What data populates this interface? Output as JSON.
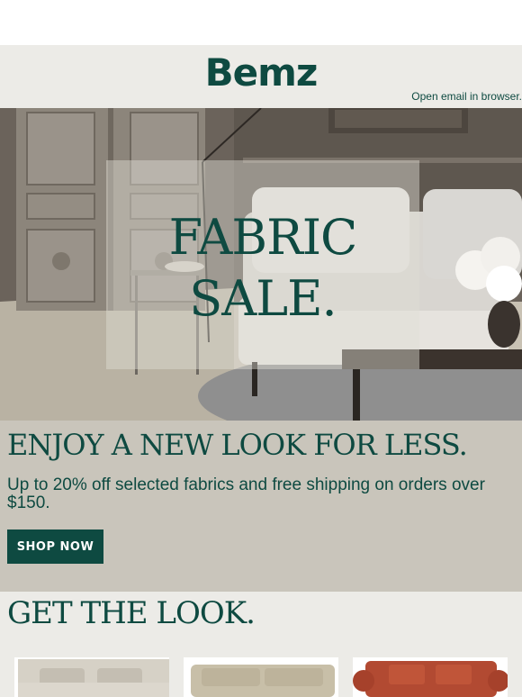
{
  "header": {
    "logo": "Bemz",
    "open_in_browser": "Open email in browser."
  },
  "hero": {
    "title_line1": "FABRIC",
    "title_line2": "SALE."
  },
  "promo": {
    "heading": "ENJOY A NEW LOOK FOR LESS.",
    "text": "Up to 20% off selected fabrics and free shipping on orders over $150.",
    "button_label": "SHOP NOW"
  },
  "look": {
    "heading": "GET THE LOOK.",
    "products": [
      {
        "name": "beige-sectional-sofa",
        "color": "#d6d1c6"
      },
      {
        "name": "taupe-sofa",
        "color": "#c8bfa8"
      },
      {
        "name": "red-rolled-arm-sofa",
        "color": "#b24a32"
      }
    ]
  },
  "colors": {
    "brand_green": "#0e4a41",
    "header_bg": "#ecebe7",
    "promo_bg": "#c9c5bb"
  }
}
